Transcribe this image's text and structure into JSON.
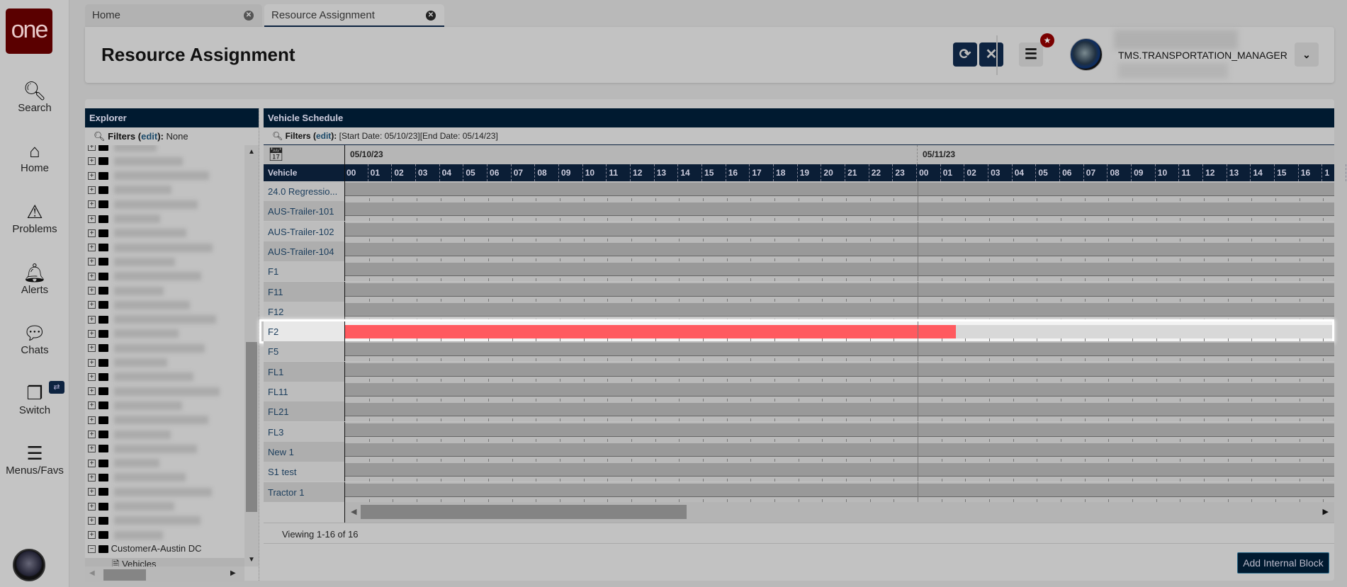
{
  "nav": {
    "logo": "one",
    "items": [
      {
        "label": "Search",
        "icon": "search-icon"
      },
      {
        "label": "Home",
        "icon": "home-icon"
      },
      {
        "label": "Problems",
        "icon": "warning-icon"
      },
      {
        "label": "Alerts",
        "icon": "bell-icon"
      },
      {
        "label": "Chats",
        "icon": "chat-icon"
      },
      {
        "label": "Switch",
        "icon": "switch-icon"
      },
      {
        "label": "Menus/Favs",
        "icon": "menu-icon"
      }
    ]
  },
  "tabs": [
    {
      "label": "Home",
      "active": false
    },
    {
      "label": "Resource Assignment",
      "active": true
    }
  ],
  "header": {
    "title": "Resource Assignment",
    "role": "TMS.TRANSPORTATION_MANAGER"
  },
  "explorer": {
    "title": "Explorer",
    "filters_label": "Filters",
    "edit_label": "edit",
    "filters_value": "None",
    "expanded_node": "CustomerA-Austin DC",
    "child_node": "Vehicles"
  },
  "schedule": {
    "title": "Vehicle Schedule",
    "filters_label": "Filters",
    "edit_label": "edit",
    "filters_value": "[Start Date: 05/10/23][End Date: 05/14/23]",
    "column_header": "Vehicle",
    "dates": [
      "05/10/23",
      "05/11/23"
    ],
    "hours": [
      "00",
      "01",
      "02",
      "03",
      "04",
      "05",
      "06",
      "07",
      "08",
      "09",
      "10",
      "11",
      "12",
      "13",
      "14",
      "15",
      "16",
      "17",
      "18",
      "19",
      "20",
      "21",
      "22",
      "23",
      "00",
      "01",
      "02",
      "03",
      "04",
      "05",
      "06",
      "07",
      "08",
      "09",
      "10",
      "11",
      "12",
      "13",
      "14",
      "15",
      "16",
      "1"
    ],
    "vehicles": [
      "24.0 Regressio...",
      "AUS-Trailer-101",
      "AUS-Trailer-102",
      "AUS-Trailer-104",
      "F1",
      "F11",
      "F12",
      "F2",
      "F5",
      "FL1",
      "FL11",
      "FL21",
      "FL3",
      "New 1",
      "S1 test",
      "Tractor 1"
    ],
    "selected_vehicle": "F2",
    "block": {
      "vehicle": "F2",
      "start_hour": 0,
      "end_hour": 25.6,
      "color": "#ff5a5f"
    },
    "pager": "Viewing 1-16 of 16",
    "add_button": "Add Internal Block"
  },
  "colors": {
    "brand": "#5a0000",
    "navy": "#001a30",
    "block": "#ff5a5f"
  }
}
